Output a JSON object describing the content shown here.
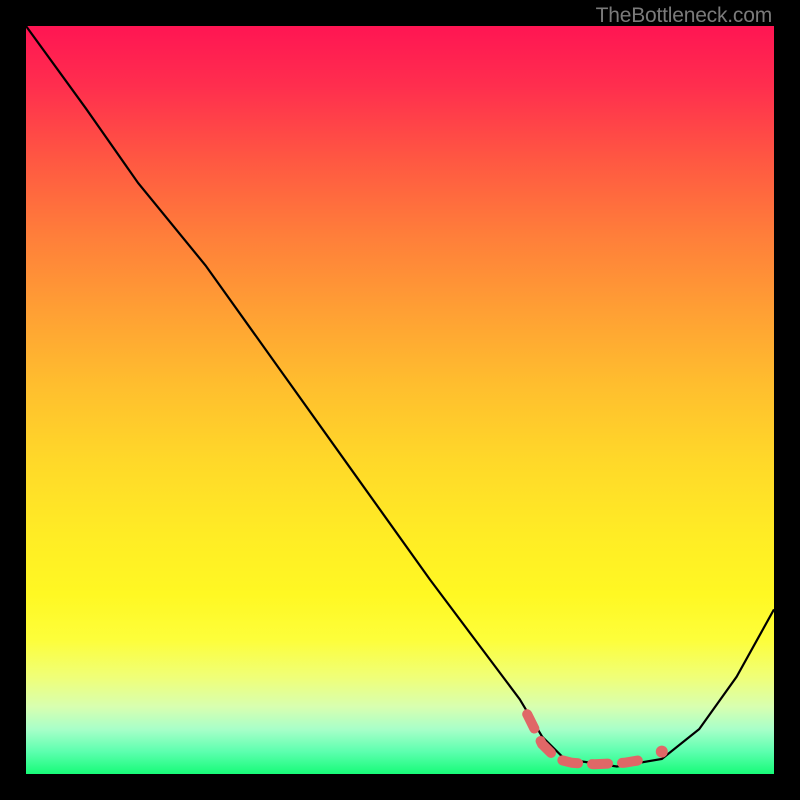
{
  "watermark": "TheBottleneck.com",
  "colors": {
    "frame": "#000000",
    "curve_main": "#000000",
    "dashed": "#e06767",
    "dot": "#e06767"
  },
  "chart_data": {
    "type": "line",
    "title": "",
    "xlabel": "",
    "ylabel": "",
    "xlim": [
      0,
      100
    ],
    "ylim": [
      0,
      100
    ],
    "series": [
      {
        "name": "bottleneck-curve",
        "style": "solid",
        "color": "#000000",
        "x": [
          0,
          8,
          15,
          24,
          34,
          44,
          54,
          60,
          66,
          69,
          72,
          79,
          85,
          90,
          95,
          100
        ],
        "y": [
          100,
          89,
          79,
          68,
          54,
          40,
          26,
          18,
          10,
          5,
          2,
          1,
          2,
          6,
          13,
          22
        ]
      },
      {
        "name": "optimal-zone",
        "style": "dashed-thick",
        "color": "#e06767",
        "x": [
          67,
          69,
          71,
          73,
          76,
          80,
          83
        ],
        "y": [
          8,
          4,
          2,
          1.5,
          1.3,
          1.5,
          2
        ]
      }
    ],
    "markers": [
      {
        "name": "optimal-point",
        "x": 85,
        "y": 3,
        "r": 4,
        "color": "#e06767"
      }
    ],
    "grid": false,
    "legend": false
  }
}
